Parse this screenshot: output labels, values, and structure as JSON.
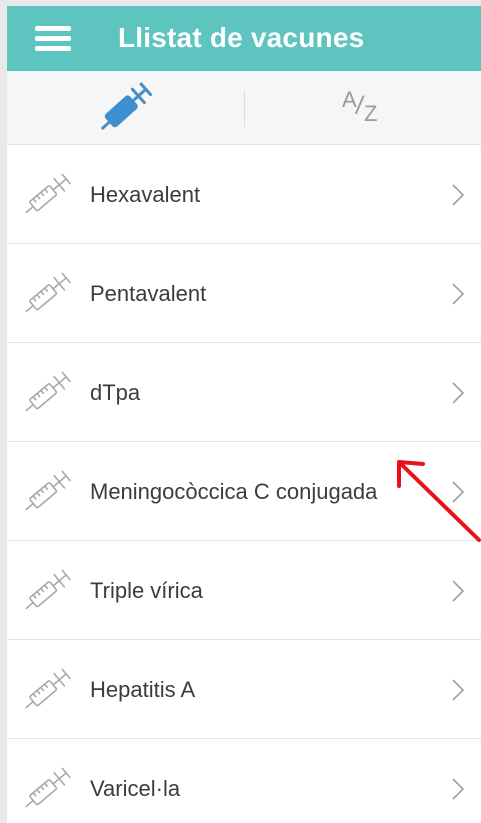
{
  "header": {
    "title": "Llistat de vacunes",
    "menu_icon": "hamburger-menu-icon"
  },
  "tabs": {
    "type_icon": "syringe-icon",
    "az_a": "A",
    "az_slash": "/",
    "az_z": "Z",
    "active": "type"
  },
  "vaccines": [
    {
      "label": "Hexavalent"
    },
    {
      "label": "Pentavalent"
    },
    {
      "label": "dTpa"
    },
    {
      "label": "Meningocòccica C conjugada"
    },
    {
      "label": "Triple vírica"
    },
    {
      "label": "Hepatitis A"
    },
    {
      "label": "Varicel·la"
    }
  ],
  "colors": {
    "header_bg": "#5ec4bf",
    "active_tab_icon": "#3f8fcf",
    "annotation_arrow": "#e8101b"
  },
  "annotation": {
    "type": "arrow-icon",
    "color": "red"
  }
}
